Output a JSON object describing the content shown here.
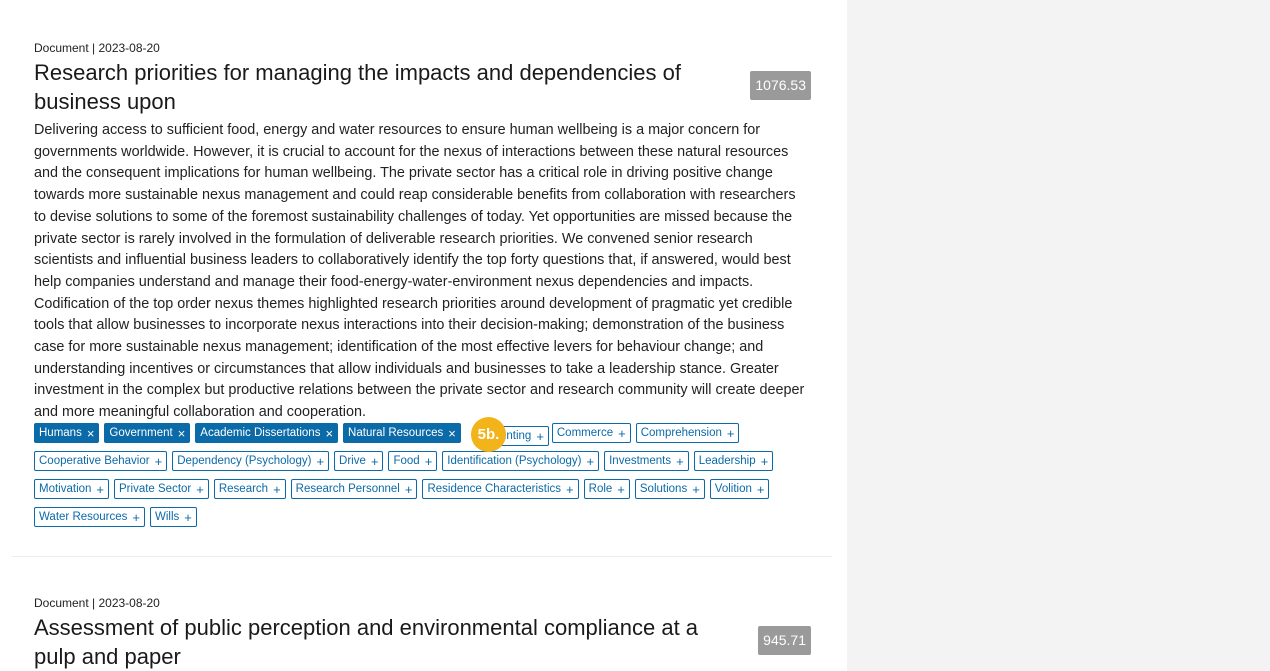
{
  "results": [
    {
      "meta": "Document | 2023-08-20",
      "title": "Research priorities for managing the impacts and dependencies of business upon",
      "score": "1076.53",
      "abstract": "Delivering access to sufficient food, energy and water resources to ensure human wellbeing is a major concern for governments worldwide. However, it is crucial to account for the nexus of interactions between these natural resources and the consequent implications for human wellbeing. The private sector has a critical role in driving positive change towards more sustainable nexus management and could reap considerable benefits from collaboration with researchers to devise solutions to some of the foremost sustainability challenges of today. Yet opportunities are missed because the private sector is rarely involved in the formulation of deliverable research priorities. We convened senior research scientists and influential business leaders to collaboratively identify the top forty questions that, if answered, would best help companies understand and manage their food-energy-water-environment nexus dependencies and impacts. Codification of the top order nexus themes highlighted research priorities around development of pragmatic yet credible tools that allow businesses to incorporate nexus interactions into their decision-making; demonstration of the business case for more sustainable nexus management; identification of the most effective levers for behaviour change; and understanding incentives or circumstances that allow individuals and businesses to take a leadership stance. Greater investment in the complex but productive relations between the private sector and research community will create deeper and more meaningful collaboration and cooperation.",
      "tags_selected": [
        "Humans",
        "Government",
        "Academic Dissertations",
        "Natural Resources"
      ],
      "tag_partial": "unting",
      "tags_row1": [
        "Commerce",
        "Comprehension"
      ],
      "tags_row2": [
        "Cooperative Behavior",
        "Dependency (Psychology)",
        "Drive",
        "Food",
        "Identification (Psychology)",
        "Investments",
        "Leadership"
      ],
      "tags_row3": [
        "Motivation",
        "Private Sector",
        "Research",
        "Research Personnel",
        "Residence Characteristics",
        "Role",
        "Solutions",
        "Volition"
      ],
      "tags_row4": [
        "Water Resources",
        "Wills"
      ]
    },
    {
      "meta": "Document | 2023-08-20",
      "title": "Assessment of public perception and environmental compliance at a pulp and paper",
      "score": "945.71"
    }
  ],
  "tag_icons": {
    "selected": "close-icon",
    "unselected": "plus-icon",
    "remove_glyph": "×",
    "add_glyph": "+"
  },
  "step_badge": "5b.",
  "colors": {
    "tag_blue": "#0b6aa8",
    "score_gray": "#9a9a9a",
    "badge_yellow": "#f2b31b",
    "side_panel": "#f3f3f3"
  }
}
